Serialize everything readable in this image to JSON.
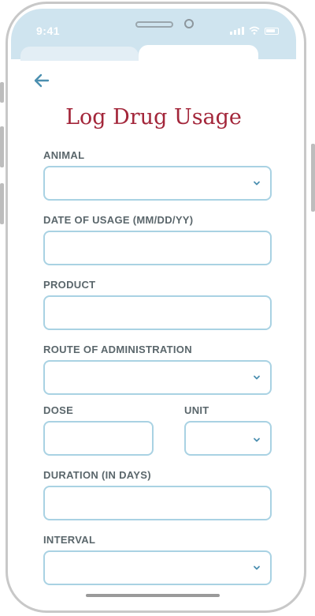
{
  "status_bar": {
    "time": "9:41",
    "icons": [
      "signal-icon",
      "wifi-icon",
      "battery-icon"
    ],
    "background": "#cfe4ef"
  },
  "header": {
    "back_icon": "arrow-left-icon",
    "title": "Log Drug Usage"
  },
  "form": {
    "animal": {
      "label": "ANIMAL",
      "value": "",
      "type": "select"
    },
    "date": {
      "label": "DATE OF USAGE (MM/DD/YY)",
      "value": "",
      "type": "text"
    },
    "product": {
      "label": "PRODUCT",
      "value": "",
      "type": "text"
    },
    "route": {
      "label": "ROUTE OF ADMINISTRATION",
      "value": "",
      "type": "select"
    },
    "dose": {
      "label": "DOSE",
      "value": "",
      "type": "text"
    },
    "unit": {
      "label": "UNIT",
      "value": "",
      "type": "select"
    },
    "duration": {
      "label": "DURATION (IN DAYS)",
      "value": "",
      "type": "text"
    },
    "interval": {
      "label": "INTERVAL",
      "value": "",
      "type": "select"
    }
  },
  "colors": {
    "title": "#a3263a",
    "label": "#5a666b",
    "field_border": "#a9d2e3",
    "accent": "#4b8fb0"
  }
}
